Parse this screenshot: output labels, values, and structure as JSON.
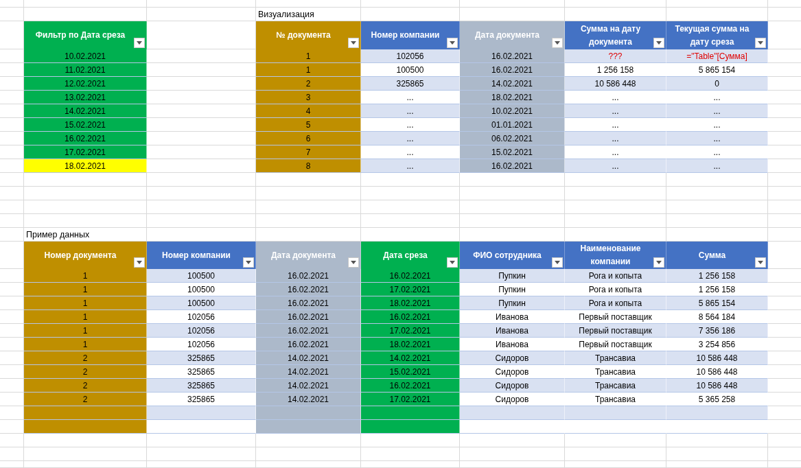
{
  "filter_table": {
    "column": {
      "label": "Фильтр по Дата среза",
      "kind": "green"
    },
    "dates": [
      {
        "value": "10.02.2021",
        "highlighted": false
      },
      {
        "value": "11.02.2021",
        "highlighted": false
      },
      {
        "value": "12.02.2021",
        "highlighted": false
      },
      {
        "value": "13.02.2021",
        "highlighted": false
      },
      {
        "value": "14.02.2021",
        "highlighted": false
      },
      {
        "value": "15.02.2021",
        "highlighted": false
      },
      {
        "value": "16.02.2021",
        "highlighted": false
      },
      {
        "value": "17.02.2021",
        "highlighted": false
      },
      {
        "value": "18.02.2021",
        "highlighted": true
      }
    ]
  },
  "visualization": {
    "title": "Визуализация",
    "columns": [
      {
        "label": "№ документа",
        "kind": "gold"
      },
      {
        "label": "Номер компании",
        "kind": "blue"
      },
      {
        "label": "Дата документа",
        "kind": "grey"
      },
      {
        "label": "Сумма на дату документа",
        "kind": "blue"
      },
      {
        "label": "Текущая сумма на дату среза",
        "kind": "blue"
      }
    ],
    "rows": [
      {
        "cells": [
          "1",
          "102056",
          "16.02.2021",
          {
            "text": "???",
            "kind": "formula"
          },
          {
            "text": "=\"Table\"[Сумма]",
            "kind": "formula"
          }
        ]
      },
      {
        "cells": [
          "1",
          "100500",
          "16.02.2021",
          "1 256 158",
          "5 865 154"
        ]
      },
      {
        "cells": [
          "2",
          "325865",
          "14.02.2021",
          "10 586 448",
          "0"
        ]
      },
      {
        "cells": [
          "3",
          "...",
          "18.02.2021",
          "...",
          "..."
        ]
      },
      {
        "cells": [
          "4",
          "...",
          "10.02.2021",
          "...",
          "..."
        ]
      },
      {
        "cells": [
          "5",
          "...",
          "01.01.2021",
          "...",
          "..."
        ]
      },
      {
        "cells": [
          "6",
          "...",
          "06.02.2021",
          "...",
          "..."
        ]
      },
      {
        "cells": [
          "7",
          "...",
          "15.02.2021",
          "...",
          "..."
        ]
      },
      {
        "cells": [
          "8",
          "...",
          "16.02.2021",
          "...",
          "..."
        ]
      }
    ]
  },
  "sample_data": {
    "title": "Пример данных",
    "columns": [
      {
        "label": "Номер документа",
        "kind": "gold"
      },
      {
        "label": "Номер компании",
        "kind": "blue"
      },
      {
        "label": "Дата документа",
        "kind": "grey"
      },
      {
        "label": "Дата среза",
        "kind": "green"
      },
      {
        "label": "ФИО сотрудника",
        "kind": "blue"
      },
      {
        "label": "Наименование компании",
        "kind": "blue"
      },
      {
        "label": "Сумма",
        "kind": "blue"
      }
    ],
    "rows": [
      {
        "blank": false,
        "cells": [
          "1",
          "100500",
          "16.02.2021",
          "16.02.2021",
          "Пупкин",
          "Рога и копыта",
          "1 256 158"
        ]
      },
      {
        "blank": false,
        "cells": [
          "1",
          "100500",
          "16.02.2021",
          "17.02.2021",
          "Пупкин",
          "Рога и копыта",
          "1 256 158"
        ]
      },
      {
        "blank": false,
        "cells": [
          "1",
          "100500",
          "16.02.2021",
          "18.02.2021",
          "Пупкин",
          "Рога и копыта",
          "5 865 154"
        ]
      },
      {
        "blank": false,
        "cells": [
          "1",
          "102056",
          "16.02.2021",
          "16.02.2021",
          "Иванова",
          "Первый поставщик",
          "8 564 184"
        ]
      },
      {
        "blank": false,
        "cells": [
          "1",
          "102056",
          "16.02.2021",
          "17.02.2021",
          "Иванова",
          "Первый поставщик",
          "7 356 186"
        ]
      },
      {
        "blank": false,
        "cells": [
          "1",
          "102056",
          "16.02.2021",
          "18.02.2021",
          "Иванова",
          "Первый поставщик",
          "3 254 856"
        ]
      },
      {
        "blank": false,
        "cells": [
          "2",
          "325865",
          "14.02.2021",
          "14.02.2021",
          "Сидоров",
          "Трансавиа",
          "10 586 448"
        ]
      },
      {
        "blank": false,
        "cells": [
          "2",
          "325865",
          "14.02.2021",
          "15.02.2021",
          "Сидоров",
          "Трансавиа",
          "10 586 448"
        ]
      },
      {
        "blank": false,
        "cells": [
          "2",
          "325865",
          "14.02.2021",
          "16.02.2021",
          "Сидоров",
          "Трансавиа",
          "10 586 448"
        ]
      },
      {
        "blank": false,
        "cells": [
          "2",
          "325865",
          "14.02.2021",
          "17.02.2021",
          "Сидоров",
          "Трансавиа",
          "5 365 258"
        ]
      },
      {
        "blank": true
      },
      {
        "blank": true
      }
    ]
  }
}
